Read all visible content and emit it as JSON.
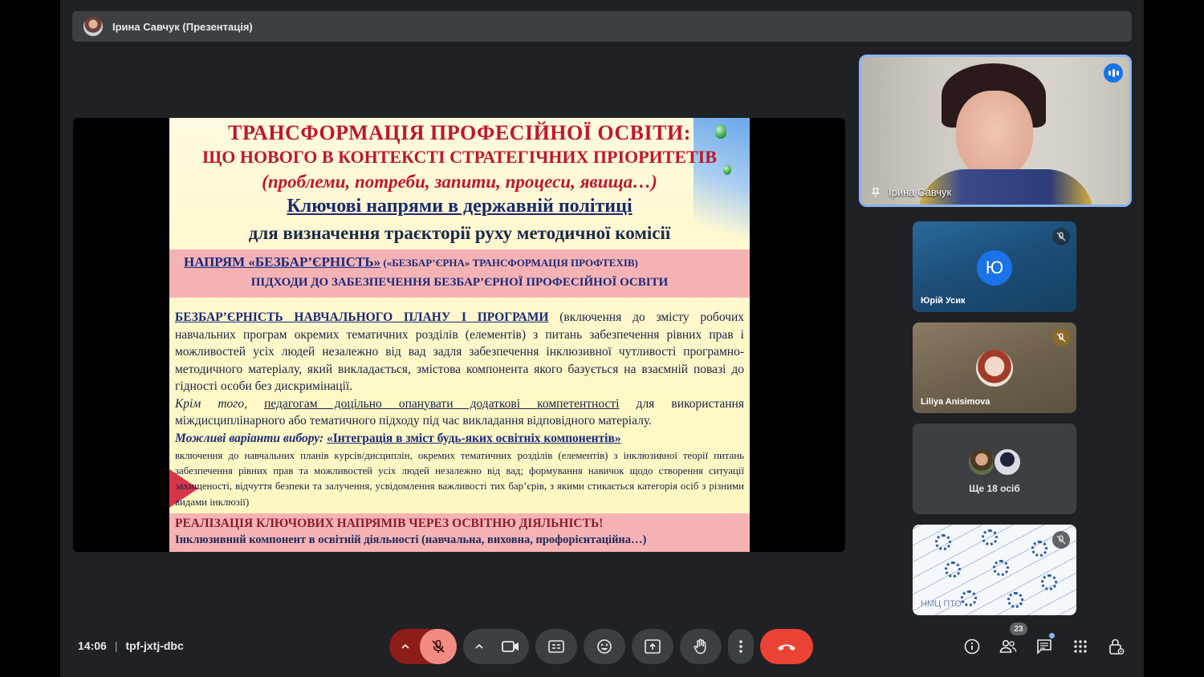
{
  "presenter_bar": {
    "label": "Ірина Савчук (Презентація)"
  },
  "slide": {
    "title1": "ТРАНСФОРМАЦІЯ ПРОФЕСІЙНОЇ ОСВІТИ:",
    "title2": "ЩО НОВОГО В КОНТЕКСТІ СТРАТЕГІЧНИХ ПРІОРИТЕТІВ",
    "title3": "(проблеми, потреби, запити, процеси, явища…)",
    "title4": "Ключові напрями в державній політиці",
    "title5": "для визначення траєкторії руху методичної комісії",
    "band1_line1_main": "НАПРЯМ «БЕЗБАР’ЄРНІСТЬ»",
    "band1_line1_small": " («БЕЗБАР’ЄРНА» ТРАНСФОРМАЦІЯ ПРОФТЕХІВ)",
    "band1_line2": "ПІДХОДИ ДО ЗАБЕЗПЕЧЕННЯ БЕЗБАР’ЄРНОЇ ПРОФЕСІЙНОЇ ОСВІТИ",
    "p1_heading": "БЕЗБАР’ЄРНІСТЬ НАВЧАЛЬНОГО ПЛАНУ І ПРОГРАМИ",
    "p1_text": " (включення до змісту робочих навчальних програм окремих тематичних розділів (елементів) з питань забезпечення рівних прав і можливостей усіх людей незалежно від вад задля забезпечення інклюзивної чутливості програмно-методичного матеріалу, який викладається, змістова компонента якого базується на взаємній повазі до гідності особи без дискримінації.",
    "p2_italic": "Крім того,",
    "p2_underline": "педагогам доцільно опанувати додаткові компетентності",
    "p2_rest": " для використання міждисциплінарного або тематичного підходу під час викладання відповідного матеріалу.",
    "p3_label": "Можливі варіанти вибору",
    "p3_colon": ": ",
    "p3_option": "«Інтеграція в зміст будь-яких освітніх компонентів»",
    "p4_small": "включення до навчальних планів курсів/дисциплін, окремих тематичних розділів (елементів) з інклюзивної теорії питань забезпечення рівних прав та можливостей усіх людей незалежно від вад; формування навичок щодо створення ситуації захищеності, відчуття безпеки та залучення, усвідомлення важливості тих бар’єрів, з якими стикається категорія осіб з різними видами інклюзії)",
    "band2_line1": "РЕАЛІЗАЦІЯ КЛЮЧОВИХ НАПРЯМІВ ЧЕРЕЗ ОСВІТНЮ ДІЯЛЬНІСТЬ!",
    "band2_line2": "Інклюзивний компонент в освітній діяльності (навчальна, виховна, профорієнтаційна…)"
  },
  "participants": {
    "main": {
      "name": "Ірина Савчук",
      "speaking": true
    },
    "tiles": [
      {
        "name": "Юрій Усик",
        "initial": "Ю",
        "muted": true
      },
      {
        "name": "Liliya Anisimova",
        "muted": true
      },
      {
        "more_label": "Ще 18 осіб"
      },
      {
        "name": "НМЦ ПТО",
        "muted": true
      }
    ]
  },
  "bottom_bar": {
    "time": "14:06",
    "separator": "|",
    "meeting_code": "tpf-jxtj-dbc",
    "people_count": "23"
  },
  "icons": [
    "chevron-up-icon",
    "mic-off-icon",
    "camera-icon",
    "captions-icon",
    "emoji-icon",
    "present-icon",
    "raise-hand-icon",
    "more-vert-icon",
    "end-call-icon",
    "info-icon",
    "people-icon",
    "chat-icon",
    "activities-icon",
    "host-controls-icon"
  ],
  "colors": {
    "end_call": "#ea4335",
    "mic_off": "#f28b82",
    "accent": "#8ab4f8",
    "slide_title": "#c0162b"
  }
}
